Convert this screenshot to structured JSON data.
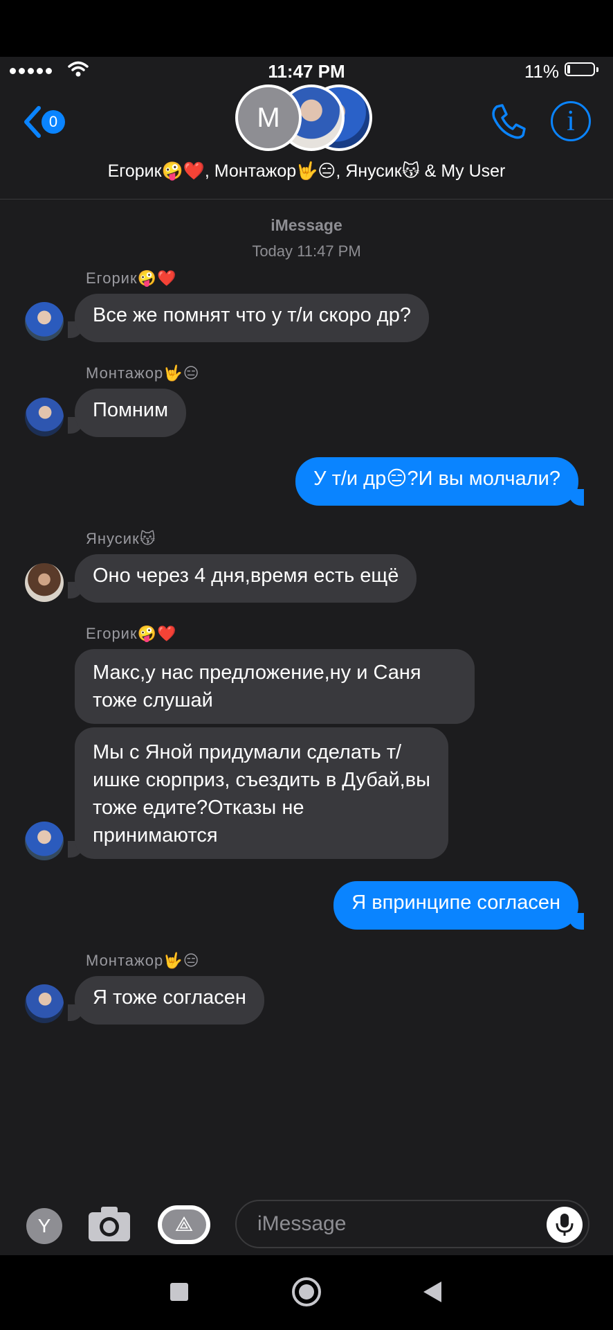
{
  "status": {
    "time": "11:47 PM",
    "battery": "11%"
  },
  "header": {
    "back_count": "0",
    "group_avatar_letter": "M",
    "chat_name": "Егорик🤪❤️, Монтажор🤟😑, Янусик😽 & My User"
  },
  "thread": {
    "service": "iMessage",
    "timestamp": "Today 11:47 PM",
    "messages": [
      {
        "sender": "Егорик🤪❤️",
        "text": "Все же помнят что у т/и скоро др?",
        "direction": "in"
      },
      {
        "sender": "Монтажор🤟😑",
        "text": "Помним",
        "direction": "in"
      },
      {
        "text": "У т/и др😑?И вы молчали?",
        "direction": "out"
      },
      {
        "sender": "Янусик😽",
        "text": "Оно через 4 дня,время есть ещё",
        "direction": "in"
      },
      {
        "sender": "Егорик🤪❤️",
        "text": "Макс,у нас предложение,ну и Саня тоже слушай",
        "direction": "in"
      },
      {
        "text": "Мы с Яной придумали сделать т/ишке сюрприз, съездить в Дубай,вы тоже едите?Отказы не принимаются",
        "direction": "in"
      },
      {
        "text": "Я впринципе согласен",
        "direction": "out"
      },
      {
        "sender": "Монтажор🤟😑",
        "text": "Я тоже согласен",
        "direction": "in"
      }
    ]
  },
  "composer": {
    "placeholder": "iMessage",
    "apps_letter": "Y"
  },
  "colors": {
    "accent": "#0a84ff",
    "incoming_bubble": "#39393d",
    "background": "#1c1c1e"
  },
  "icons": [
    "back-chevron-icon",
    "phone-icon",
    "info-icon",
    "camera-icon",
    "app-store-icon",
    "microphone-icon",
    "wifi-icon"
  ]
}
